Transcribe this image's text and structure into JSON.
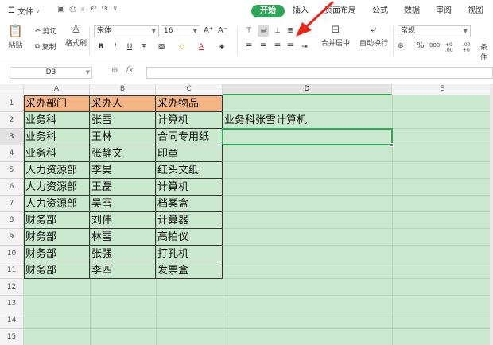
{
  "ribbon": {
    "file_menu": "文件",
    "tabs": [
      {
        "label": "开始",
        "active": true
      },
      {
        "label": "插入",
        "active": false
      },
      {
        "label": "页面布局",
        "active": false
      },
      {
        "label": "公式",
        "active": false
      },
      {
        "label": "数据",
        "active": false
      },
      {
        "label": "审阅",
        "active": false
      },
      {
        "label": "视图",
        "active": false
      }
    ],
    "paste_label": "粘贴",
    "cut_label": "剪切",
    "copy_label": "复制",
    "format_painter_label": "格式刷",
    "font_name": "宋体",
    "font_size": "16",
    "increase_font": "A⁺",
    "decrease_font": "A⁻",
    "bold": "B",
    "italic": "I",
    "underline": "U",
    "merge_center_label": "合并居中",
    "wrap_text_label": "自动换行",
    "number_format": "常规",
    "percent": "%",
    "thousands": "000",
    "inc_decimal": "+0 .00",
    "dec_decimal": ".00 +0",
    "conditional_label": "条件"
  },
  "formula_bar": {
    "name_box": "D3",
    "fx_label": "fx",
    "formula": ""
  },
  "grid": {
    "columns": [
      "A",
      "B",
      "C",
      "D",
      "E"
    ],
    "selected_column": "D",
    "rows": [
      "1",
      "2",
      "3",
      "4",
      "5",
      "6",
      "7",
      "8",
      "9",
      "10",
      "11",
      "12",
      "13",
      "14",
      "15"
    ],
    "selected_row": "3",
    "cells": [
      [
        "采办部门",
        "采办人",
        "采办物品",
        ""
      ],
      [
        "业务科",
        "张雪",
        "计算机",
        "业务科张雪计算机"
      ],
      [
        "业务科",
        "王林",
        "合同专用纸",
        ""
      ],
      [
        "业务科",
        "张静文",
        "印章",
        ""
      ],
      [
        "人力资源部",
        "李昊",
        "红头文纸",
        ""
      ],
      [
        "人力资源部",
        "王磊",
        "计算机",
        ""
      ],
      [
        "人力资源部",
        "吴雪",
        "档案盒",
        ""
      ],
      [
        "财务部",
        "刘伟",
        "计算器",
        ""
      ],
      [
        "财务部",
        "林雪",
        "高拍仪",
        ""
      ],
      [
        "财务部",
        "张强",
        "打孔机",
        ""
      ],
      [
        "财务部",
        "李四",
        "发票盒",
        ""
      ]
    ]
  },
  "colors": {
    "accent": "#31a55a",
    "header_fill": "#f6b384",
    "sheet_fill": "#c9e8cd",
    "arrow": "#e8261c"
  }
}
